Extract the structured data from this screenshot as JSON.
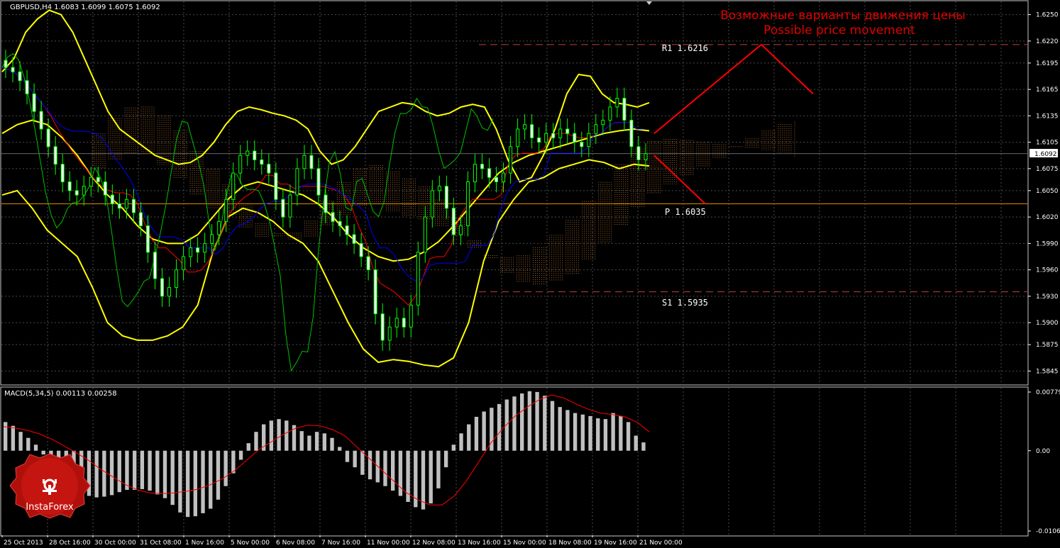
{
  "window": {
    "header": "GBPUSD,H4  1.6083 1.6099 1.6075 1.6092",
    "annotation_ru": "Возможные варианты движения цены",
    "annotation_en": "Possible price movement"
  },
  "logo": {
    "text": "InstaForex"
  },
  "colors": {
    "background": "#000000",
    "bull_candle": "#00ff00",
    "bear_candle": "#ffffff",
    "bollinger": "#ffff00",
    "kijun": "#ff0000",
    "tenkan": "#0000ff",
    "chikou": "#00c000",
    "cloud": "#c07838",
    "pivot_line": "#e08a00",
    "sr_line": "#c04040",
    "forecast": "#ff0000",
    "macd_hist": "#c0c0c0",
    "macd_signal": "#ff0000"
  },
  "chart_data": [
    {
      "type": "candlestick",
      "symbol": "GBPUSD",
      "timeframe": "H4",
      "last": {
        "open": 1.6083,
        "high": 1.6099,
        "low": 1.6075,
        "close": 1.6092
      },
      "current_price_label": "1.6092",
      "ylim": [
        1.583,
        1.6265
      ],
      "y_ticks": [
        "1.6250",
        "1.6220",
        "1.6195",
        "1.6165",
        "1.6135",
        "1.6105",
        "1.6075",
        "1.6050",
        "1.6020",
        "1.5990",
        "1.5960",
        "1.5930",
        "1.5900",
        "1.5875",
        "1.5845"
      ],
      "x_ticks": [
        "25 Oct 2013",
        "28 Oct 16:00",
        "30 Oct 00:00",
        "31 Oct 08:00",
        "1 Nov 16:00",
        "5 Nov 00:00",
        "6 Nov 08:00",
        "7 Nov 16:00",
        "11 Nov 00:00",
        "12 Nov 08:00",
        "13 Nov 16:00",
        "15 Nov 00:00",
        "18 Nov 08:00",
        "19 Nov 16:00",
        "21 Nov 00:00"
      ],
      "levels": [
        {
          "name": "R1",
          "label": "R1  1.6216",
          "value": 1.6216
        },
        {
          "name": "P",
          "label": "P  1.6035",
          "value": 1.6035
        },
        {
          "name": "S1",
          "label": "S1  1.5935",
          "value": 1.5935
        }
      ],
      "close_path": [
        1.619,
        1.6185,
        1.6175,
        1.616,
        1.614,
        1.612,
        1.61,
        1.608,
        1.606,
        1.605,
        1.6045,
        1.6055,
        1.6065,
        1.606,
        1.6045,
        1.6035,
        1.603,
        1.604,
        1.6025,
        1.601,
        1.598,
        1.595,
        1.593,
        1.594,
        1.596,
        1.5975,
        1.5985,
        1.598,
        1.599,
        1.6,
        1.6015,
        1.604,
        1.607,
        1.609,
        1.6095,
        1.6085,
        1.608,
        1.607,
        1.604,
        1.602,
        1.6045,
        1.6075,
        1.609,
        1.6075,
        1.6045,
        1.6025,
        1.6015,
        1.601,
        1.6,
        1.599,
        1.5975,
        1.596,
        1.591,
        1.588,
        1.5895,
        1.5905,
        1.5895,
        1.592,
        1.598,
        1.602,
        1.605,
        1.6055,
        1.603,
        1.6,
        1.601,
        1.606,
        1.608,
        1.6075,
        1.6065,
        1.606,
        1.607,
        1.61,
        1.612,
        1.6125,
        1.611,
        1.6105,
        1.6115,
        1.611,
        1.612,
        1.6115,
        1.6105,
        1.61,
        1.6115,
        1.6125,
        1.613,
        1.6145,
        1.6155,
        1.613,
        1.61,
        1.6085,
        1.6092
      ],
      "bollinger_upper": [
        1.6185,
        1.62,
        1.623,
        1.6245,
        1.6255,
        1.625,
        1.623,
        1.62,
        1.617,
        1.614,
        1.612,
        1.611,
        1.61,
        1.609,
        1.6085,
        1.608,
        1.6082,
        1.609,
        1.6105,
        1.6125,
        1.614,
        1.6145,
        1.6142,
        1.6138,
        1.6135,
        1.613,
        1.612,
        1.6095,
        1.608,
        1.6085,
        1.61,
        1.612,
        1.614,
        1.6145,
        1.615,
        1.6148,
        1.614,
        1.6135,
        1.6138,
        1.6145,
        1.6148,
        1.6145,
        1.612,
        1.6085,
        1.606,
        1.6065,
        1.609,
        1.612,
        1.616,
        1.6182,
        1.618,
        1.616,
        1.615,
        1.6148,
        1.6145,
        1.615
      ],
      "bollinger_middle": [
        1.6115,
        1.6125,
        1.613,
        1.6125,
        1.611,
        1.609,
        1.6065,
        1.6045,
        1.603,
        1.601,
        1.5995,
        1.599,
        1.599,
        1.6,
        1.602,
        1.604,
        1.6055,
        1.606,
        1.6055,
        1.605,
        1.6045,
        1.6035,
        1.602,
        1.6,
        1.5985,
        1.5975,
        1.597,
        1.5972,
        1.598,
        1.5992,
        1.601,
        1.603,
        1.605,
        1.607,
        1.6082,
        1.609,
        1.6095,
        1.61,
        1.6105,
        1.611,
        1.6115,
        1.6118,
        1.612,
        1.6118
      ],
      "bollinger_lower": [
        1.6045,
        1.605,
        1.603,
        1.6005,
        1.599,
        1.5975,
        1.594,
        1.59,
        1.5885,
        1.588,
        1.588,
        1.5885,
        1.5895,
        1.592,
        1.598,
        1.602,
        1.603,
        1.6025,
        1.6015,
        1.6,
        1.599,
        1.597,
        1.5935,
        1.59,
        1.587,
        1.5855,
        1.5858,
        1.5856,
        1.5852,
        1.585,
        1.586,
        1.59,
        1.597,
        1.6015,
        1.604,
        1.606,
        1.6065,
        1.6075,
        1.608,
        1.6085,
        1.6082,
        1.6075,
        1.608,
        1.6078
      ],
      "forecast": [
        {
          "name": "up",
          "points": [
            [
              1.6115,
              0
            ],
            [
              1.6216,
              1
            ],
            [
              1.616,
              2
            ]
          ]
        },
        {
          "name": "down",
          "points": [
            [
              1.609,
              0
            ],
            [
              1.6035,
              1
            ]
          ]
        }
      ]
    },
    {
      "type": "bar",
      "indicator": "MACD",
      "label": "MACD(5,34,5) 0.00113 0.00258",
      "ylim": [
        -0.01066,
        0.00779
      ],
      "y_ticks": [
        "0.00779",
        "0.00",
        "-0.01066"
      ],
      "histogram": [
        0.0038,
        0.0033,
        0.0025,
        0.0017,
        0.0008,
        -0.0005,
        -0.0012,
        -0.0018,
        -0.003,
        -0.0042,
        -0.0052,
        -0.006,
        -0.0062,
        -0.0061,
        -0.0059,
        -0.0055,
        -0.0052,
        -0.0052,
        -0.0051,
        -0.0053,
        -0.0058,
        -0.0063,
        -0.0072,
        -0.0082,
        -0.0088,
        -0.0087,
        -0.0083,
        -0.0077,
        -0.0065,
        -0.0047,
        -0.003,
        -0.0012,
        0.001,
        0.0025,
        0.0035,
        0.004,
        0.0042,
        0.004,
        0.0034,
        0.0026,
        0.002,
        0.0025,
        0.0023,
        0.0017,
        0.0005,
        -0.0015,
        -0.0022,
        -0.0032,
        -0.0038,
        -0.0042,
        -0.0047,
        -0.0053,
        -0.006,
        -0.0068,
        -0.0075,
        -0.0078,
        -0.007,
        -0.005,
        -0.0022,
        0.0008,
        0.0023,
        0.0035,
        0.0045,
        0.0052,
        0.0057,
        0.0062,
        0.0068,
        0.0072,
        0.0076,
        0.0079,
        0.0078,
        0.0073,
        0.0066,
        0.0058,
        0.0054,
        0.005,
        0.0048,
        0.0046,
        0.0043,
        0.0042,
        0.005,
        0.0046,
        0.0038,
        0.002,
        0.0011
      ],
      "signal": [
        0.0032,
        0.003,
        0.0027,
        0.0022,
        0.0015,
        0.0006,
        -0.0003,
        -0.0013,
        -0.0025,
        -0.0035,
        -0.0045,
        -0.0052,
        -0.0056,
        -0.0057,
        -0.0056,
        -0.0054,
        -0.0051,
        -0.0045,
        -0.0037,
        -0.0026,
        -0.0012,
        0.0002,
        0.0012,
        0.0022,
        0.003,
        0.0034,
        0.0033,
        0.0028,
        0.002,
        0.0005,
        -0.001,
        -0.0025,
        -0.004,
        -0.0055,
        -0.0065,
        -0.0072,
        -0.0072,
        -0.006,
        -0.004,
        -0.0015,
        0.001,
        0.003,
        0.0046,
        0.0058,
        0.0068,
        0.0074,
        0.007,
        0.0062,
        0.0055,
        0.005,
        0.0048,
        0.0045,
        0.0038,
        0.0025
      ]
    }
  ]
}
